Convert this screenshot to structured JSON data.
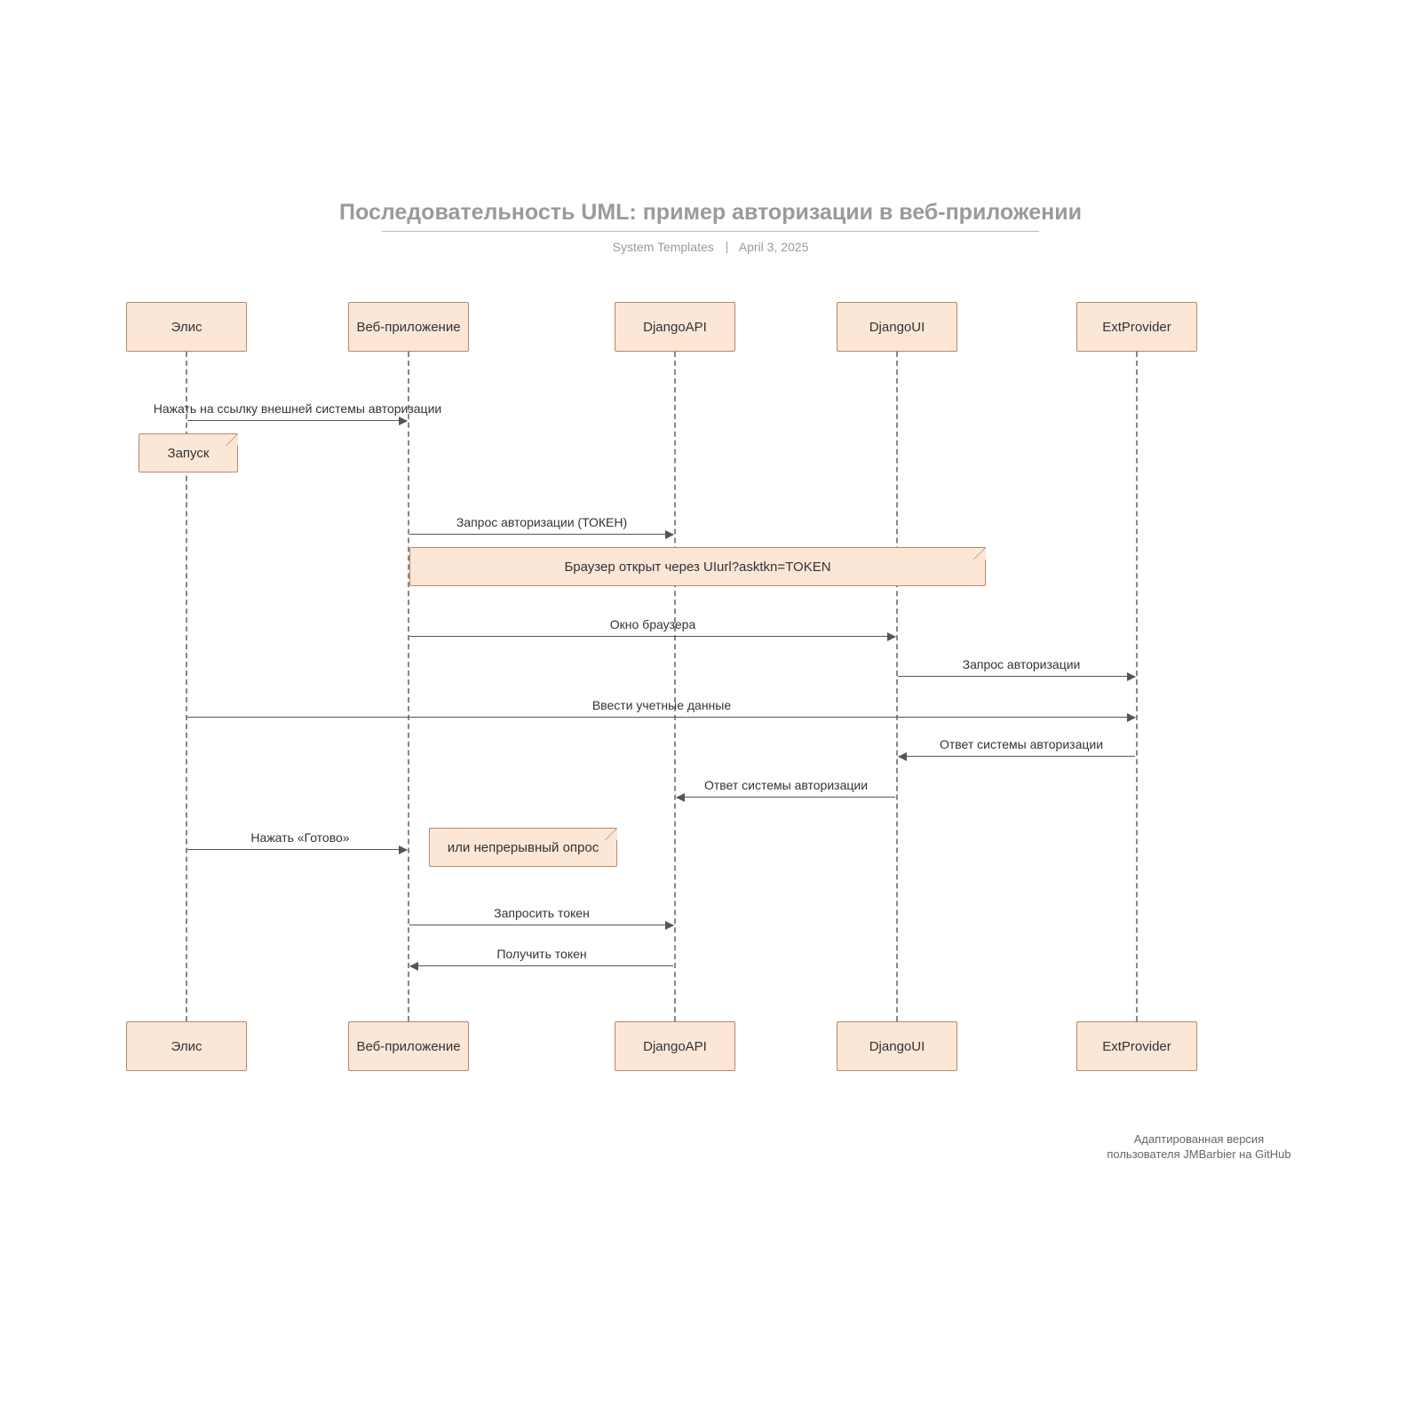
{
  "header": {
    "title": "Последовательность UML: пример авторизации в веб-приложении",
    "subtitle_left": "System Templates",
    "subtitle_right": "April 3, 2025"
  },
  "participants": {
    "p1": "Элис",
    "p2": "Веб-приложение",
    "p3": "DjangoAPI",
    "p4": "DjangoUI",
    "p5": "ExtProvider"
  },
  "messages": {
    "m1": "Нажать на ссылку внешней системы авторизации",
    "m2": "Запрос авторизации (ТОКЕН)",
    "m3": "Окно браузера",
    "m4": "Запрос авторизации",
    "m5": "Ввести учетные данные",
    "m6": "Ответ системы авторизации",
    "m7": "Ответ системы авторизации",
    "m8": "Нажать «Готово»",
    "m9": "Запросить токен",
    "m10": "Получить токен"
  },
  "notes": {
    "n1": "Запуск",
    "n2": "Браузер открыт через UIurl?asktkn=TOKEN",
    "n3": "или непрерывный опрос"
  },
  "footer": {
    "line1": "Адаптированная версия",
    "line2": "пользователя JMBarbier на GitHub"
  }
}
